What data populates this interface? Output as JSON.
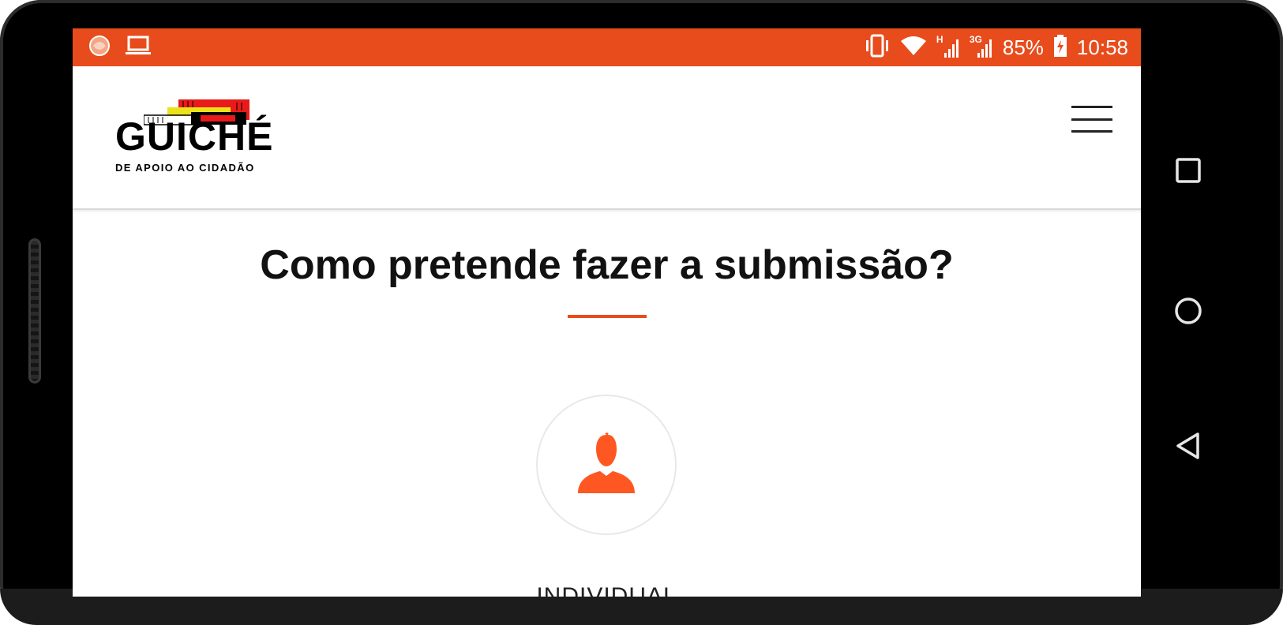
{
  "status_bar": {
    "battery": "85%",
    "time": "10:58",
    "network_h": "H",
    "network_3g": "3G"
  },
  "header": {
    "logo": {
      "title": "GUICHÉ",
      "subtitle": "DE APOIO AO CIDADÃO"
    }
  },
  "main": {
    "title": "Como pretende fazer a submissão?",
    "options": [
      {
        "label": "INDIVIDUAL",
        "icon": "person-icon"
      }
    ]
  },
  "colors": {
    "accent": "#e84c1c",
    "icon": "#ff5722"
  }
}
